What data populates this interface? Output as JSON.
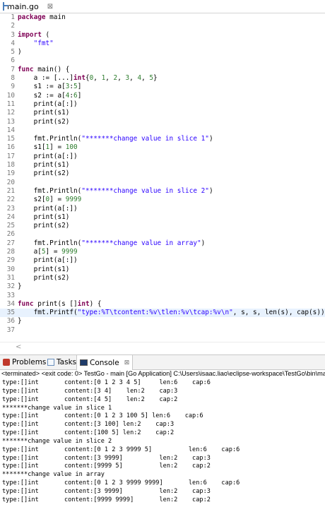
{
  "editor_tab": {
    "label": "main.go",
    "close": "⊠"
  },
  "editor": {
    "lines": [
      {
        "n": "1",
        "code": [
          [
            "kw",
            "package"
          ],
          [
            "",
            " main"
          ]
        ]
      },
      {
        "n": "2",
        "code": []
      },
      {
        "n": "3",
        "fold": "⊖",
        "code": [
          [
            "kw",
            "import"
          ],
          [
            "",
            " ("
          ]
        ]
      },
      {
        "n": "4",
        "code": [
          [
            "",
            "    "
          ],
          [
            "str",
            "\"fmt\""
          ]
        ]
      },
      {
        "n": "5",
        "code": [
          [
            "",
            ")"
          ]
        ]
      },
      {
        "n": "6",
        "code": []
      },
      {
        "n": "7",
        "fold": "⊖",
        "code": [
          [
            "kw",
            "func"
          ],
          [
            "",
            " main() {"
          ]
        ]
      },
      {
        "n": "8",
        "code": [
          [
            "",
            "    a := [...]"
          ],
          [
            "kw",
            "int"
          ],
          [
            "",
            "{"
          ],
          [
            "num",
            "0"
          ],
          [
            "",
            ", "
          ],
          [
            "num",
            "1"
          ],
          [
            "",
            ", "
          ],
          [
            "num",
            "2"
          ],
          [
            "",
            ", "
          ],
          [
            "num",
            "3"
          ],
          [
            "",
            ", "
          ],
          [
            "num",
            "4"
          ],
          [
            "",
            ", "
          ],
          [
            "num",
            "5"
          ],
          [
            "",
            "}"
          ]
        ]
      },
      {
        "n": "9",
        "code": [
          [
            "",
            "    s1 := a["
          ],
          [
            "num",
            "3"
          ],
          [
            "",
            ":"
          ],
          [
            "num",
            "5"
          ],
          [
            "",
            "]"
          ]
        ]
      },
      {
        "n": "10",
        "code": [
          [
            "",
            "    s2 := a["
          ],
          [
            "num",
            "4"
          ],
          [
            "",
            ":"
          ],
          [
            "num",
            "6"
          ],
          [
            "",
            "]"
          ]
        ]
      },
      {
        "n": "11",
        "code": [
          [
            "",
            "    print(a[:])"
          ]
        ]
      },
      {
        "n": "12",
        "code": [
          [
            "",
            "    print(s1)"
          ]
        ]
      },
      {
        "n": "13",
        "code": [
          [
            "",
            "    print(s2)"
          ]
        ]
      },
      {
        "n": "14",
        "code": []
      },
      {
        "n": "15",
        "code": [
          [
            "",
            "    fmt.Println("
          ],
          [
            "str",
            "\"*******change value in slice 1\""
          ],
          [
            "",
            ")"
          ]
        ]
      },
      {
        "n": "16",
        "code": [
          [
            "",
            "    s1["
          ],
          [
            "num",
            "1"
          ],
          [
            "",
            "] = "
          ],
          [
            "num",
            "100"
          ]
        ]
      },
      {
        "n": "17",
        "code": [
          [
            "",
            "    print(a[:])"
          ]
        ]
      },
      {
        "n": "18",
        "code": [
          [
            "",
            "    print(s1)"
          ]
        ]
      },
      {
        "n": "19",
        "code": [
          [
            "",
            "    print(s2)"
          ]
        ]
      },
      {
        "n": "20",
        "code": []
      },
      {
        "n": "21",
        "code": [
          [
            "",
            "    fmt.Println("
          ],
          [
            "str",
            "\"*******change value in slice 2\""
          ],
          [
            "",
            ")"
          ]
        ]
      },
      {
        "n": "22",
        "code": [
          [
            "",
            "    s2["
          ],
          [
            "num",
            "0"
          ],
          [
            "",
            "] = "
          ],
          [
            "num",
            "9999"
          ]
        ]
      },
      {
        "n": "23",
        "code": [
          [
            "",
            "    print(a[:])"
          ]
        ]
      },
      {
        "n": "24",
        "code": [
          [
            "",
            "    print(s1)"
          ]
        ]
      },
      {
        "n": "25",
        "code": [
          [
            "",
            "    print(s2)"
          ]
        ]
      },
      {
        "n": "26",
        "code": []
      },
      {
        "n": "27",
        "code": [
          [
            "",
            "    fmt.Println("
          ],
          [
            "str",
            "\"*******change value in array\""
          ],
          [
            "",
            ")"
          ]
        ]
      },
      {
        "n": "28",
        "code": [
          [
            "",
            "    a["
          ],
          [
            "num",
            "5"
          ],
          [
            "",
            "] = "
          ],
          [
            "num",
            "9999"
          ]
        ]
      },
      {
        "n": "29",
        "code": [
          [
            "",
            "    print(a[:])"
          ]
        ]
      },
      {
        "n": "30",
        "code": [
          [
            "",
            "    print(s1)"
          ]
        ]
      },
      {
        "n": "31",
        "code": [
          [
            "",
            "    print(s2)"
          ]
        ]
      },
      {
        "n": "32",
        "code": [
          [
            "",
            "}"
          ]
        ]
      },
      {
        "n": "33",
        "code": []
      },
      {
        "n": "34",
        "fold": "⊖",
        "code": [
          [
            "kw",
            "func"
          ],
          [
            "",
            " print(s []"
          ],
          [
            "kw",
            "int"
          ],
          [
            "",
            ") {"
          ]
        ]
      },
      {
        "n": "35",
        "hl": true,
        "code": [
          [
            "",
            "    fmt.Printf("
          ],
          [
            "str",
            "\"type:%T\\tcontent:%v\\tlen:%v\\tcap:%v\\n\""
          ],
          [
            "",
            ", s, s, len(s), cap(s))"
          ]
        ]
      },
      {
        "n": "36",
        "code": [
          [
            "",
            "}"
          ]
        ]
      },
      {
        "n": "37",
        "code": []
      }
    ]
  },
  "views": {
    "problems": "Problems",
    "tasks": "Tasks",
    "console": "Console",
    "close": "⊠"
  },
  "console_header": "<terminated> <exit code: 0> TestGo - main [Go Application] C:\\Users\\isaac.liao\\eclipse-workspace\\TestGo\\bin\\ma",
  "console_lines": [
    "type:[]int       content:[0 1 2 3 4 5]     len:6    cap:6",
    "type:[]int       content:[3 4]    len:2    cap:3",
    "type:[]int       content:[4 5]    len:2    cap:2",
    "*******change value in slice 1",
    "type:[]int       content:[0 1 2 3 100 5] len:6    cap:6",
    "type:[]int       content:[3 100] len:2    cap:3",
    "type:[]int       content:[100 5] len:2    cap:2",
    "*******change value in slice 2",
    "type:[]int       content:[0 1 2 3 9999 5]          len:6    cap:6",
    "type:[]int       content:[3 9999]          len:2    cap:3",
    "type:[]int       content:[9999 5]          len:2    cap:2",
    "*******change value in array",
    "type:[]int       content:[0 1 2 3 9999 9999]       len:6    cap:6",
    "type:[]int       content:[3 9999]          len:2    cap:3",
    "type:[]int       content:[9999 9999]       len:2    cap:2"
  ]
}
